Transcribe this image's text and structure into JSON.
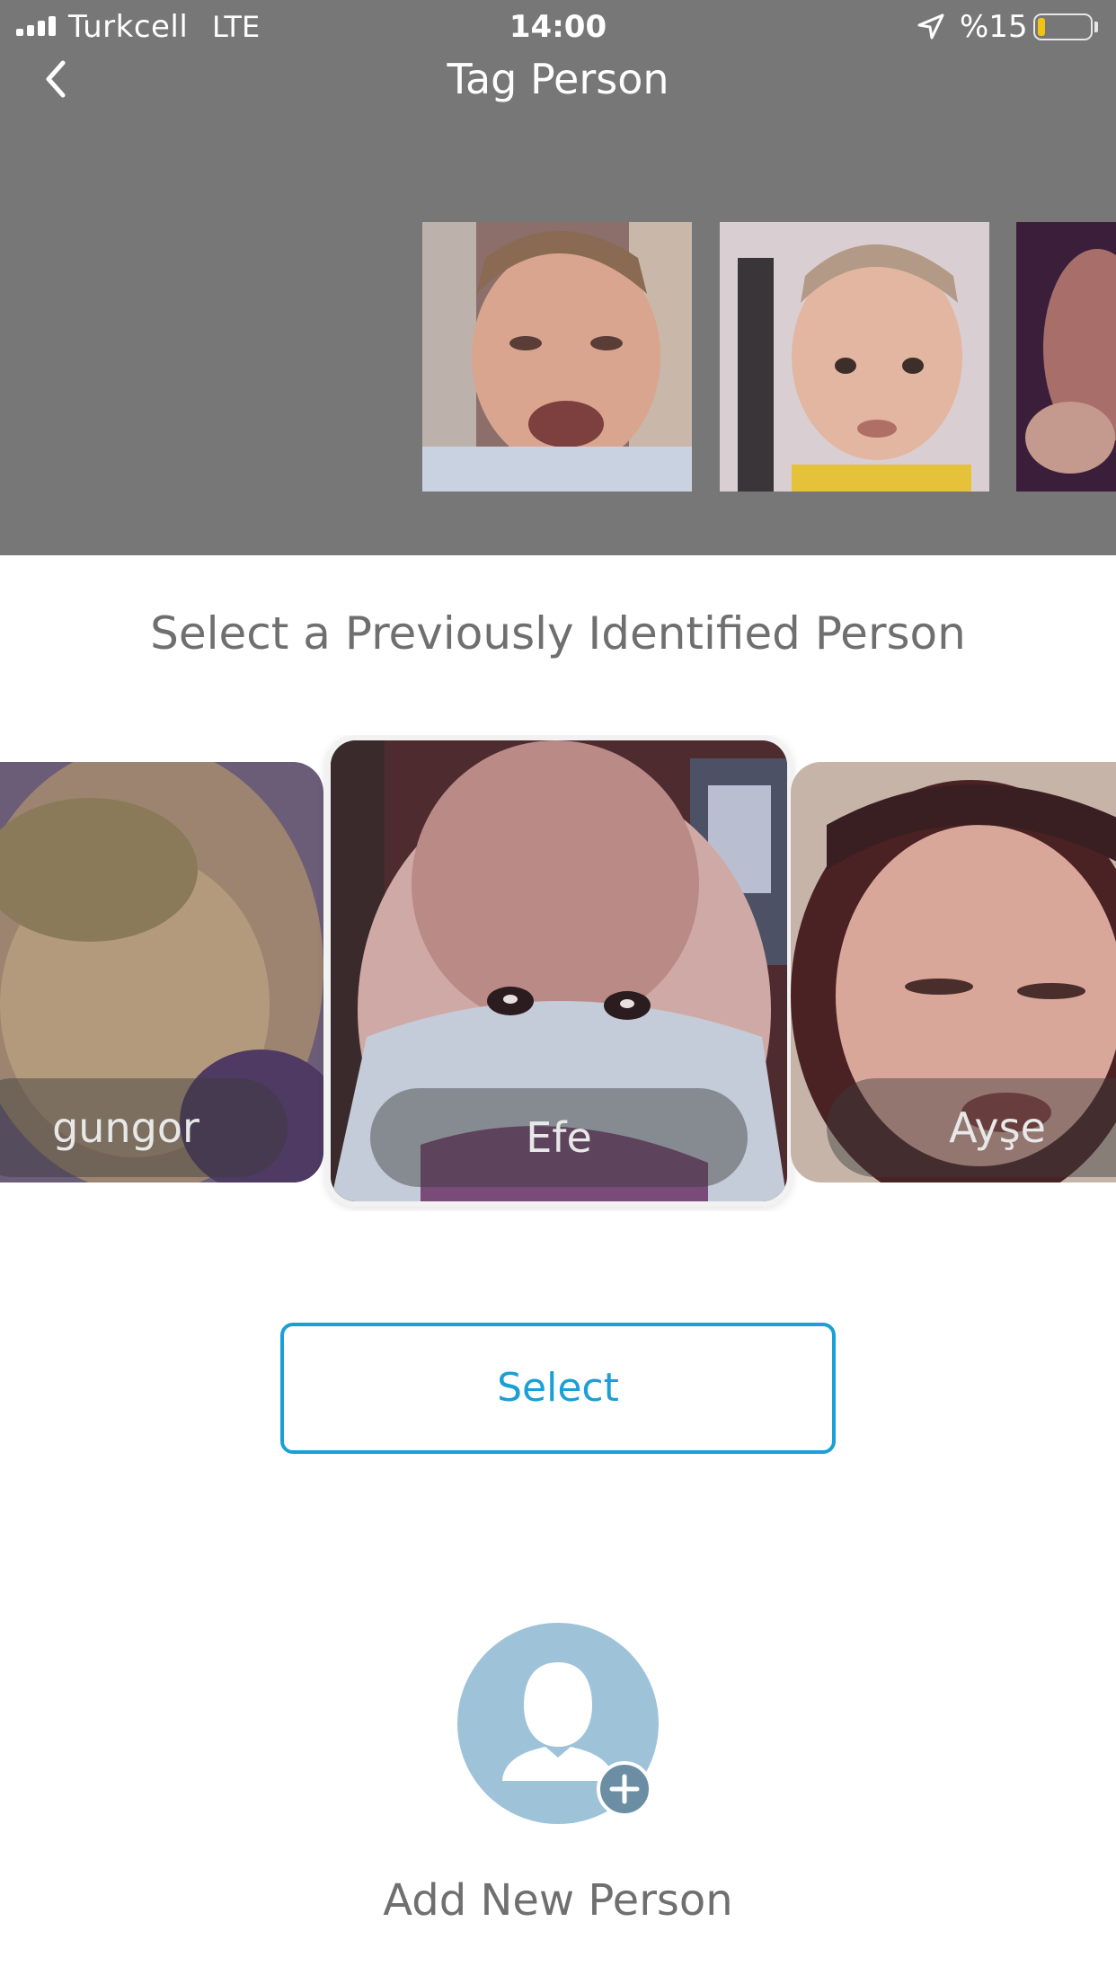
{
  "status_bar": {
    "carrier": "Turkcell",
    "network": "LTE",
    "time": "14:00",
    "battery_percent_text": "%15",
    "battery_level": 0.15,
    "location_icon": "location-arrow-icon"
  },
  "nav": {
    "back_icon": "chevron-left-icon",
    "title": "Tag Person"
  },
  "detected_faces": {
    "count_visible": 3
  },
  "section": {
    "heading": "Select a Previously Identified Person"
  },
  "people": [
    {
      "name": "gungor"
    },
    {
      "name": "Efe"
    },
    {
      "name": "Ayşe"
    }
  ],
  "select_button": {
    "label": "Select"
  },
  "add_person": {
    "icon": "user-add-icon",
    "label": "Add New Person"
  },
  "colors": {
    "header_gray": "#777777",
    "accent": "#1a9fd6",
    "avatar_bg": "#9ec3d9",
    "badge_bg": "#6b8ea5",
    "text_gray": "#6f6f6f"
  }
}
